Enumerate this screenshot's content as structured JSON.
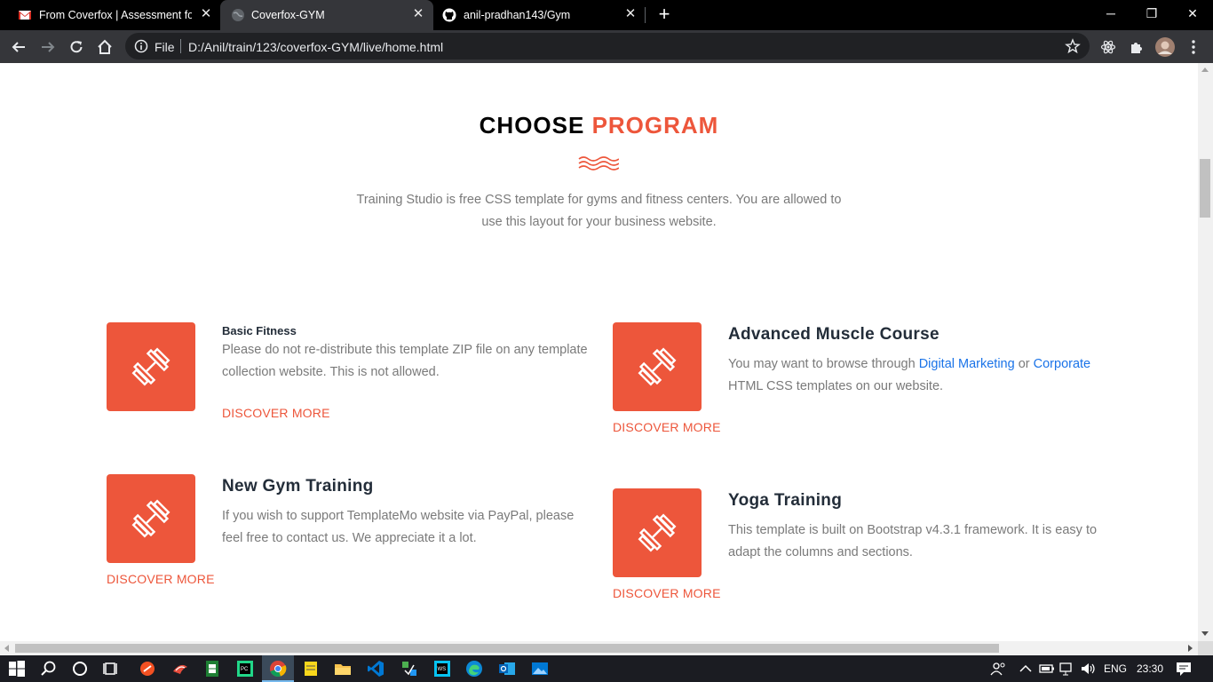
{
  "browser": {
    "tabs": [
      {
        "title": "From Coverfox | Assessment for F",
        "icon": "gmail-icon",
        "active": false
      },
      {
        "title": "Coverfox-GYM",
        "icon": "globe-icon",
        "active": true
      },
      {
        "title": "anil-pradhan143/Gym",
        "icon": "github-icon",
        "active": false
      }
    ],
    "new_tab": "+",
    "address": {
      "scheme_label": "File",
      "url": "D:/Anil/train/123/coverfox-GYM/live/home.html"
    }
  },
  "page": {
    "heading": {
      "part1": "CHOOSE",
      "part2": "PROGRAM"
    },
    "intro": "Training Studio is free CSS template for gyms and fitness centers. You are allowed to use this layout for your business website.",
    "programs": [
      {
        "title": "Basic Fitness",
        "description": "Please do not re-distribute this template ZIP file on any template collection website. This is not allowed.",
        "cta": "DISCOVER MORE"
      },
      {
        "title": "Advanced Muscle Course",
        "description_parts": {
          "before": "You may want to browse through ",
          "link1": "Digital Marketing",
          "middle": " or ",
          "link2": "Corporate",
          "after": " HTML CSS templates on our website."
        },
        "cta": "DISCOVER MORE"
      },
      {
        "title": "New Gym Training",
        "description": "If you wish to support TemplateMo website via PayPal, please feel free to contact us. We appreciate it a lot.",
        "cta": "DISCOVER MORE"
      },
      {
        "title": "Yoga Training",
        "description": "This template is built on Bootstrap v4.3.1 framework. It is easy to adapt the columns and sections.",
        "cta": "DISCOVER MORE"
      }
    ],
    "accent_color": "#ed563b"
  },
  "taskbar": {
    "language": "ENG",
    "time": "23:30"
  }
}
